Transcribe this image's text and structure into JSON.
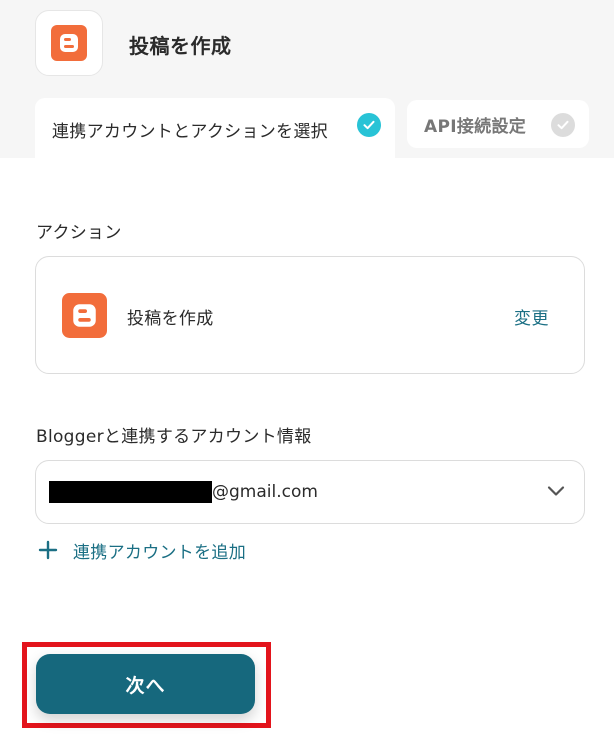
{
  "header": {
    "title": "投稿を作成",
    "app_icon": "blogger-icon"
  },
  "tabs": [
    {
      "label": "連携アカウントとアクションを選択",
      "state": "active",
      "icon": "check-circle-icon"
    },
    {
      "label": "API接続設定",
      "state": "inactive",
      "icon": "check-circle-icon"
    }
  ],
  "action": {
    "section_label": "アクション",
    "name": "投稿を作成",
    "icon": "blogger-icon",
    "change_label": "変更"
  },
  "account": {
    "section_label": "Bloggerと連携するアカウント情報",
    "selected_value_suffix": "@gmail.com",
    "selected_value_redacted": true,
    "add_label": "連携アカウントを追加"
  },
  "footer": {
    "next_label": "次へ"
  },
  "colors": {
    "accent": "#16687d",
    "link": "#1b6f84",
    "check_active": "#28c3d6",
    "blogger_orange": "#f26d3b",
    "highlight_red": "#e3141c"
  }
}
